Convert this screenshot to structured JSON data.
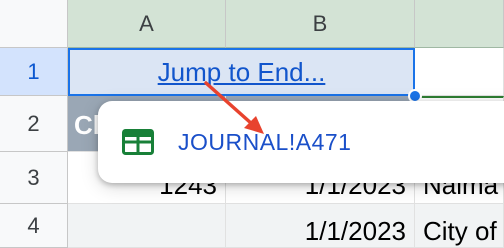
{
  "columns": {
    "a": "A",
    "b": "B"
  },
  "rows": {
    "r1": "1",
    "r2": "2",
    "r3": "3",
    "r4": "4"
  },
  "cells": {
    "a1_link": "Jump to End...",
    "a2_partial": "Cl",
    "a3": "1243",
    "b3": "1/1/2023",
    "c3": "Naima",
    "b4": "1/1/2023",
    "c4": "City of"
  },
  "popup": {
    "icon": "sheet-grid-icon",
    "link_text": "JOURNAL!A471"
  },
  "colors": {
    "selection": "#1a73e8",
    "link": "#1155cc",
    "arrow": "#e8432e",
    "sheets_green": "#188038"
  }
}
